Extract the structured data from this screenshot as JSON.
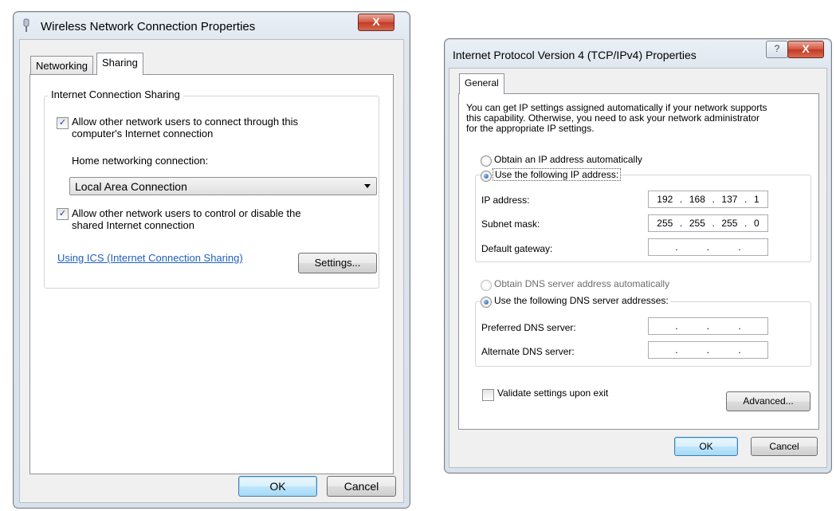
{
  "left_dialog": {
    "title": "Wireless Network Connection Properties",
    "close_label": "X",
    "tabs": [
      {
        "label": "Networking",
        "active": false
      },
      {
        "label": "Sharing",
        "active": true
      }
    ],
    "group_title": "Internet Connection Sharing",
    "allow_connect_label_line1": "Allow other network users to connect through this",
    "allow_connect_label_line2": "computer's Internet connection",
    "allow_connect_checked": true,
    "home_networking_label": "Home networking connection:",
    "home_networking_value": "Local Area Connection",
    "allow_control_label_line1": "Allow other network users to control or disable the",
    "allow_control_label_line2": "shared Internet connection",
    "allow_control_checked": true,
    "ics_link": "Using ICS (Internet Connection Sharing)",
    "settings_button": "Settings...",
    "ok_button": "OK",
    "cancel_button": "Cancel"
  },
  "right_dialog": {
    "title": "Internet Protocol Version 4 (TCP/IPv4) Properties",
    "help_label": "?",
    "close_label": "X",
    "tab": "General",
    "description_line1": "You can get IP settings assigned automatically if your network supports",
    "description_line2": "this capability. Otherwise, you need to ask your network administrator",
    "description_line3": "for the appropriate IP settings.",
    "obtain_ip_auto": "Obtain an IP address automatically",
    "use_following_ip": "Use the following IP address:",
    "ip_address_label": "IP address:",
    "ip_address": [
      "192",
      "168",
      "137",
      "1"
    ],
    "subnet_mask_label": "Subnet mask:",
    "subnet_mask": [
      "255",
      "255",
      "255",
      "0"
    ],
    "default_gateway_label": "Default gateway:",
    "default_gateway": [
      "",
      "",
      "",
      ""
    ],
    "obtain_dns_auto": "Obtain DNS server address automatically",
    "use_following_dns": "Use the following DNS server addresses:",
    "preferred_dns_label": "Preferred DNS server:",
    "preferred_dns": [
      "",
      "",
      "",
      ""
    ],
    "alternate_dns_label": "Alternate DNS server:",
    "alternate_dns": [
      "",
      "",
      "",
      ""
    ],
    "validate_label": "Validate settings upon exit",
    "validate_checked": false,
    "advanced_button": "Advanced...",
    "ok_button": "OK",
    "cancel_button": "Cancel"
  },
  "colors": {
    "link": "#1f5fbf",
    "close_red": "#c23a26",
    "window_frame": "#d9e1ea"
  }
}
